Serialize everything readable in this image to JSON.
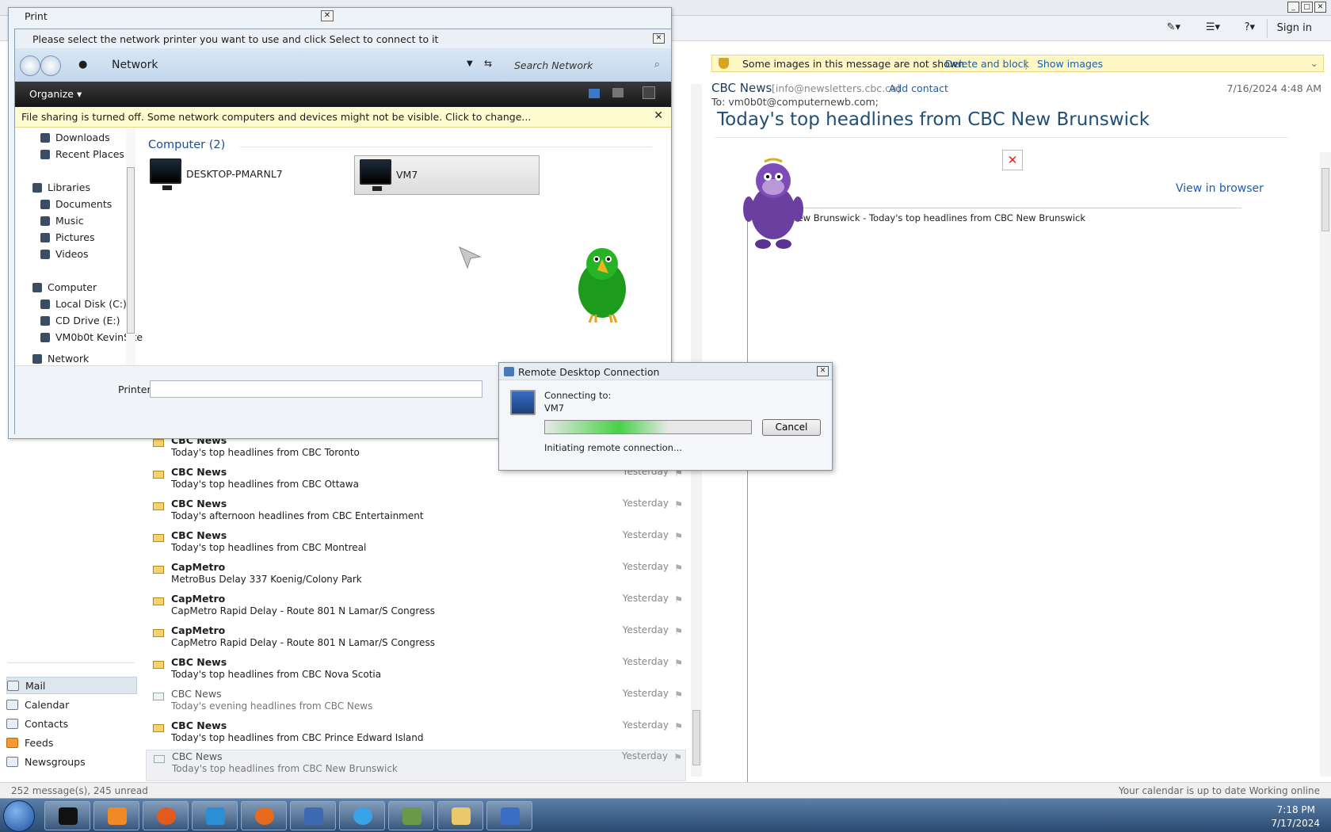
{
  "mail": {
    "toolbar": {
      "sign_in": "Sign in"
    },
    "nav": {
      "items": [
        {
          "label": "Mail",
          "icon": "mail-icon"
        },
        {
          "label": "Calendar",
          "icon": "calendar-icon"
        },
        {
          "label": "Contacts",
          "icon": "contacts-icon"
        },
        {
          "label": "Feeds",
          "icon": "feeds-icon"
        },
        {
          "label": "Newsgroups",
          "icon": "newsgroups-icon"
        }
      ]
    },
    "messages": [
      {
        "from": "CBC News",
        "subject": "Today's top headlines from CBC Toronto",
        "date": "",
        "read": false
      },
      {
        "from": "CBC News",
        "subject": "Today's top headlines from CBC Ottawa",
        "date": "Yesterday",
        "read": false
      },
      {
        "from": "CBC News",
        "subject": "Today's afternoon headlines from CBC Entertainment",
        "date": "Yesterday",
        "read": false
      },
      {
        "from": "CBC News",
        "subject": "Today's top headlines from CBC Montreal",
        "date": "Yesterday",
        "read": false
      },
      {
        "from": "CapMetro",
        "subject": "MetroBus Delay 337 Koenig/Colony Park",
        "date": "Yesterday",
        "read": false
      },
      {
        "from": "CapMetro",
        "subject": "CapMetro Rapid Delay - Route 801 N Lamar/S Congress",
        "date": "Yesterday",
        "read": false
      },
      {
        "from": "CapMetro",
        "subject": "CapMetro Rapid Delay - Route 801 N Lamar/S Congress",
        "date": "Yesterday",
        "read": false
      },
      {
        "from": "CBC News",
        "subject": "Today's top headlines from CBC Nova Scotia",
        "date": "Yesterday",
        "read": false
      },
      {
        "from": "CBC News",
        "subject": "Today's evening headlines from CBC News",
        "date": "Yesterday",
        "read": true
      },
      {
        "from": "CBC News",
        "subject": "Today's top headlines from CBC Prince Edward Island",
        "date": "Yesterday",
        "read": false
      },
      {
        "from": "CBC News",
        "subject": "Today's top headlines from CBC New Brunswick",
        "date": "Yesterday",
        "read": true
      }
    ],
    "reading": {
      "info_bar_text": "Some images in this message are not shown",
      "delete_block": "Delete and block",
      "pipe": "|",
      "show_images": "Show images",
      "from_name": "CBC News",
      "from_email": "[info@newsletters.cbc.ca]",
      "add_contact": "Add contact",
      "date": "7/16/2024 4:48 AM",
      "to": "To:  vm0b0t@computernewb.com;",
      "subject": "Today's top headlines from CBC New Brunswick",
      "view_in_browser": "View in browser",
      "body_line": "New Brunswick - Today's top headlines from CBC New Brunswick"
    },
    "status": {
      "left": "252 message(s), 245 unread",
      "right": "Your calendar is up to date   Working online"
    }
  },
  "print": {
    "title": "Print",
    "net": {
      "title": "Please select the network printer you want to use and click Select to connect to it",
      "address": "Network",
      "search": "Search Network",
      "organize": "Organize",
      "share_bar": "File sharing is turned off. Some network computers and devices might not be visible. Click to change...",
      "tree": [
        "Downloads",
        "Recent Places",
        "Libraries",
        "Documents",
        "Music",
        "Pictures",
        "Videos",
        "Computer",
        "Local Disk (C:)",
        "CD Drive (E:)",
        "VM0b0t KevinSite",
        "Network"
      ],
      "group": "Computer (2)",
      "computers": [
        "DESKTOP-PMARNL7",
        "VM7"
      ],
      "printer_label": "Printer"
    }
  },
  "rdp": {
    "title": "Remote Desktop Connection",
    "connecting": "Connecting to:",
    "target": "VM7",
    "progress": 0.6,
    "cancel": "Cancel",
    "status": "Initiating remote connection..."
  },
  "taskbar": {
    "time": "7:18 PM",
    "date": "7/17/2024"
  }
}
